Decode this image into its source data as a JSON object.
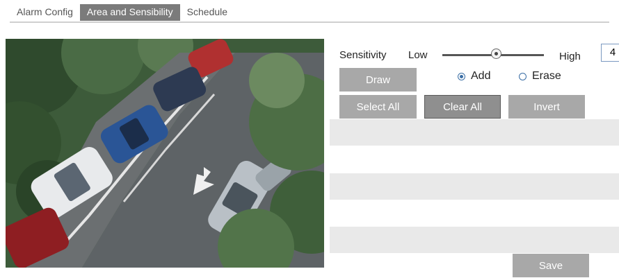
{
  "tabs": [
    {
      "label": "Alarm Config",
      "active": false
    },
    {
      "label": "Area and Sensibility",
      "active": true
    },
    {
      "label": "Schedule",
      "active": false
    }
  ],
  "sensitivity": {
    "label": "Sensitivity",
    "low_label": "Low",
    "high_label": "High",
    "value": "4"
  },
  "buttons": {
    "draw": "Draw",
    "select_all": "Select All",
    "clear_all": "Clear All",
    "invert": "Invert",
    "save": "Save"
  },
  "mode": {
    "add_label": "Add",
    "erase_label": "Erase",
    "selected": "Add"
  },
  "colors": {
    "active_tab": "#7b7b7b",
    "button": "#a8a8a8",
    "radio_accent": "#3a6ea5",
    "stripe": "#e9e9e9"
  },
  "preview": {
    "content": "camera-parking-lot-view"
  }
}
